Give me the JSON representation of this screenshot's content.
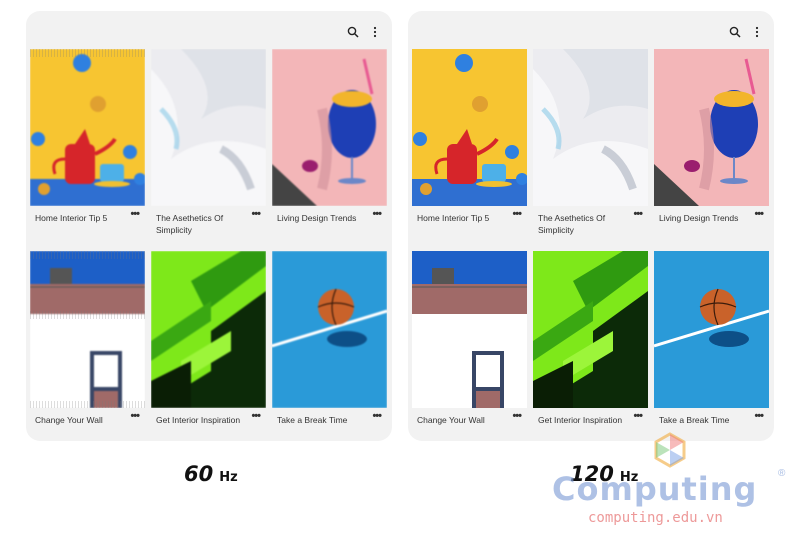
{
  "panels": [
    {
      "id": "60hz",
      "label_number": "60",
      "label_unit": "Hz",
      "cards": [
        {
          "title": "Home Interior Tip 5",
          "image": "red-kettle-still-life"
        },
        {
          "title": "The Asethetics Of Simplicity",
          "image": "white-fabric"
        },
        {
          "title": "Living Design Trends",
          "image": "blue-cocktail"
        },
        {
          "title": "Change Your Wall",
          "image": "white-building"
        },
        {
          "title": "Get Interior Inspiration",
          "image": "green-stairs"
        },
        {
          "title": "Take a Break Time",
          "image": "basketball-court"
        }
      ]
    },
    {
      "id": "120hz",
      "label_number": "120",
      "label_unit": "Hz",
      "cards": [
        {
          "title": "Home Interior Tip 5",
          "image": "red-kettle-still-life"
        },
        {
          "title": "The Asethetics Of Simplicity",
          "image": "white-fabric"
        },
        {
          "title": "Living Design Trends",
          "image": "blue-cocktail"
        },
        {
          "title": "Change Your Wall",
          "image": "white-building"
        },
        {
          "title": "Get Interior Inspiration",
          "image": "green-stairs"
        },
        {
          "title": "Take a Break Time",
          "image": "basketball-court"
        }
      ]
    }
  ],
  "more_symbol": "•••",
  "icons": {
    "search": "search-icon",
    "menu": "more-vertical-icon"
  },
  "watermark": {
    "brand": "Computing",
    "registered": "®",
    "url": "computing.edu.vn"
  },
  "colors": {
    "panel_bg": "#f2f2f2",
    "watermark_blue": "#82a0d7",
    "watermark_red": "#e66e6e"
  }
}
